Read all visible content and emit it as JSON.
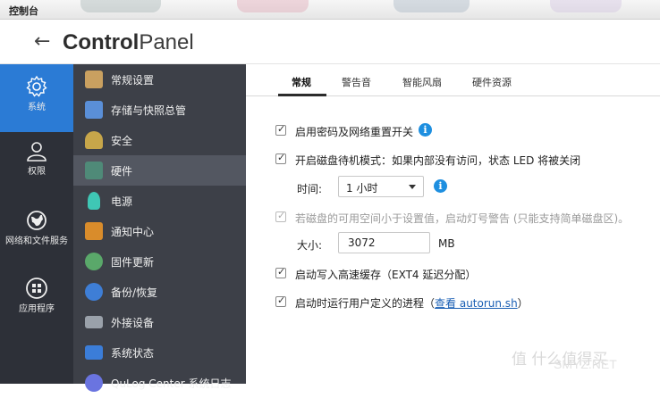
{
  "window": {
    "title": "控制台"
  },
  "header": {
    "back_icon": "arrow-left-icon",
    "brand_bold": "Control",
    "brand_light": "Panel"
  },
  "categories": [
    {
      "label": "系统",
      "icon": "gear-icon",
      "active": true
    },
    {
      "label": "权限",
      "icon": "user-icon",
      "active": false
    },
    {
      "label": "网络和文件服务",
      "icon": "globe-icon",
      "active": false
    },
    {
      "label": "应用程序",
      "icon": "apps-grid-icon",
      "active": false
    }
  ],
  "menu": [
    {
      "label": "常规设置",
      "icon": "general-settings-icon",
      "color": "#c9a060"
    },
    {
      "label": "存储与快照总管",
      "icon": "storage-icon",
      "color": "#5a8fd8"
    },
    {
      "label": "安全",
      "icon": "lock-icon",
      "color": "#c7a64a"
    },
    {
      "label": "硬件",
      "icon": "hardware-icon",
      "color": "#4f8a78",
      "active": true
    },
    {
      "label": "电源",
      "icon": "power-bulb-icon",
      "color": "#3fc7b5"
    },
    {
      "label": "通知中心",
      "icon": "notification-icon",
      "color": "#d98c2b"
    },
    {
      "label": "固件更新",
      "icon": "firmware-update-icon",
      "color": "#5aa86a"
    },
    {
      "label": "备份/恢复",
      "icon": "backup-restore-icon",
      "color": "#3e7ed6"
    },
    {
      "label": "外接设备",
      "icon": "external-device-icon",
      "color": "#9aa1aa"
    },
    {
      "label": "系统状态",
      "icon": "system-status-icon",
      "color": "#3b7dd8"
    },
    {
      "label": "QuLog Center 系统日志",
      "icon": "log-icon",
      "color": "#6a74e0"
    }
  ],
  "tabs": [
    {
      "label": "常规",
      "active": true
    },
    {
      "label": "警告音",
      "active": false
    },
    {
      "label": "智能风扇",
      "active": false
    },
    {
      "label": "硬件资源",
      "active": false
    }
  ],
  "settings": {
    "reset_switch": "启用密码及网络重置开关",
    "disk_standby": "开启磁盘待机模式：如果内部没有访问，状态 LED 将被关闭",
    "time_label": "时间:",
    "time_value": "1 小时",
    "space_warning": "若磁盘的可用空间小于设置值，启动灯号警告 (只能支持简单磁盘区)。",
    "size_label": "大小:",
    "size_value": "3072",
    "size_unit": "MB",
    "write_cache": "启动写入高速缓存（EXT4 延迟分配）",
    "autorun_prefix": "启动时运行用户定义的进程",
    "autorun_link": "查看 autorun.sh",
    "info_glyph": "i"
  },
  "watermark": {
    "text": "值 什么值得买",
    "domain": "SMYZ.NET"
  },
  "colors": {
    "accent": "#2b7bd5",
    "sidebar_dark": "#2d3038",
    "menu_bg": "#3d4048",
    "info": "#1e8fe0"
  }
}
